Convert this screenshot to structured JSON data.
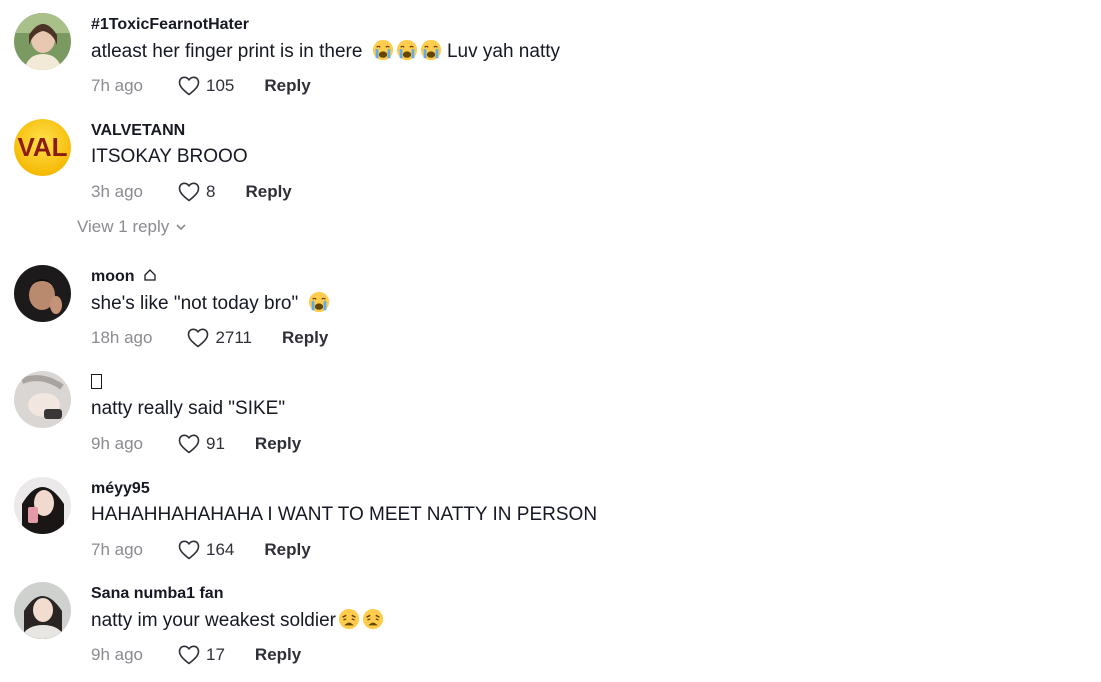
{
  "colors": {
    "text_primary": "#161823",
    "text_secondary": "#8a8b91",
    "action_text": "#2f3037"
  },
  "comments": [
    {
      "username": "#1ToxicFearnotHater",
      "text_before": "atleast her finger print is in there",
      "emojis": [
        "loudly-crying-face",
        "loudly-crying-face",
        "loudly-crying-face"
      ],
      "text_after": "Luv yah natty",
      "time": "7h ago",
      "likes": "105",
      "reply_label": "Reply",
      "avatar": "photo-girl-outdoors"
    },
    {
      "username": "VALVETANN",
      "text_before": "ITSOKAY BROOO",
      "time": "3h ago",
      "likes": "8",
      "reply_label": "Reply",
      "avatar_text": "VAL",
      "avatar": "yellow-logo"
    },
    {
      "username": "moon",
      "username_icon": "house-outline-icon",
      "text_before": "she's like \"not today bro\"",
      "emojis": [
        "loudly-crying-face"
      ],
      "time": "18h ago",
      "likes": "2711",
      "reply_label": "Reply",
      "avatar": "photo-dark-portrait"
    },
    {
      "username": "",
      "username_icon": "missing-glyph-box",
      "text_before": "natty really said \"SIKE\"",
      "time": "9h ago",
      "likes": "91",
      "reply_label": "Reply",
      "avatar": "photo-hand-light"
    },
    {
      "username": "méyy95",
      "text_before": "HAHAHHAHAHAHA I WANT TO MEET NATTY IN PERSON",
      "time": "7h ago",
      "likes": "164",
      "reply_label": "Reply",
      "avatar": "photo-mirror-selfie"
    },
    {
      "username": "Sana numba1 fan",
      "text_before": "natty im your weakest soldier",
      "emojis": [
        "weary-face",
        "weary-face"
      ],
      "time": "9h ago",
      "likes": "17",
      "reply_label": "Reply",
      "avatar": "photo-girl-sweater"
    }
  ],
  "view_replies": {
    "label": "View 1 reply"
  }
}
